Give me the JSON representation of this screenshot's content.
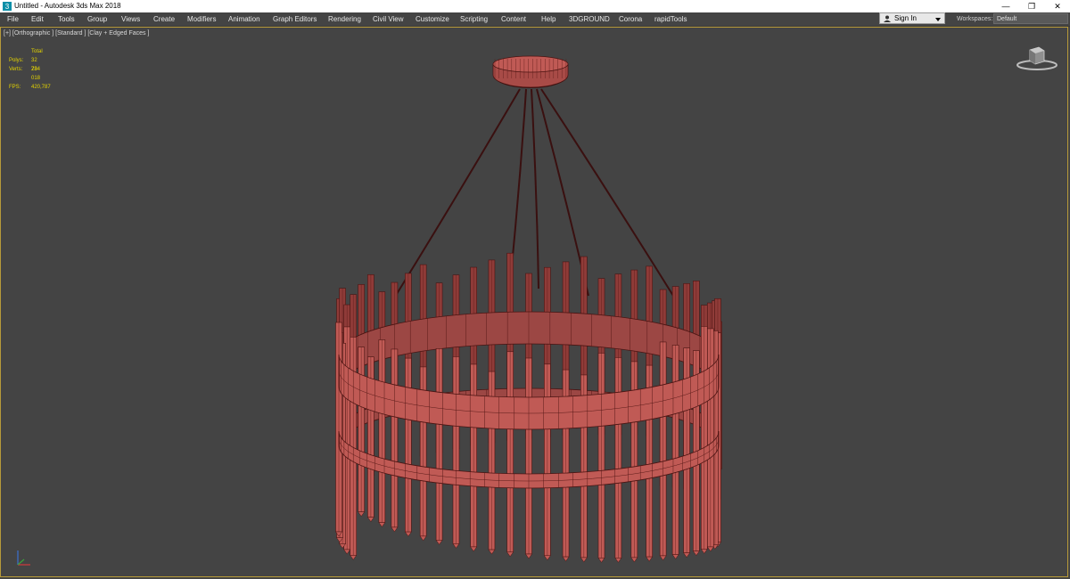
{
  "window": {
    "title": "Untitled - Autodesk 3ds Max 2018",
    "controls": {
      "minimize": "—",
      "restore": "❐",
      "close": "✕"
    }
  },
  "menu": [
    "File",
    "Edit",
    "Tools",
    "Group",
    "Views",
    "Create",
    "Modifiers",
    "Animation",
    "Graph Editors",
    "Rendering",
    "Civil View",
    "Customize",
    "Scripting",
    "Content",
    "Help",
    "3DGROUND",
    "Corona",
    "rapidTools"
  ],
  "account": {
    "sign_in": "Sign In",
    "workspaces_label": "Workspaces:",
    "workspace_value": "Default"
  },
  "viewport": {
    "label": "[+] [Orthographic ] [Standard ] [Clay + Edged Faces ]",
    "stats": {
      "header": "Total",
      "polys_label": "Polys:",
      "polys": "32 784",
      "verts_label": "Verts:",
      "verts": "23 018",
      "fps_label": "FPS:",
      "fps": "420,787"
    }
  },
  "colors": {
    "viewport_bg": "#444444",
    "model": "#c05a55",
    "cable": "#3a1010",
    "stats_text": "#e4d400",
    "active_border": "#b79a3a"
  }
}
